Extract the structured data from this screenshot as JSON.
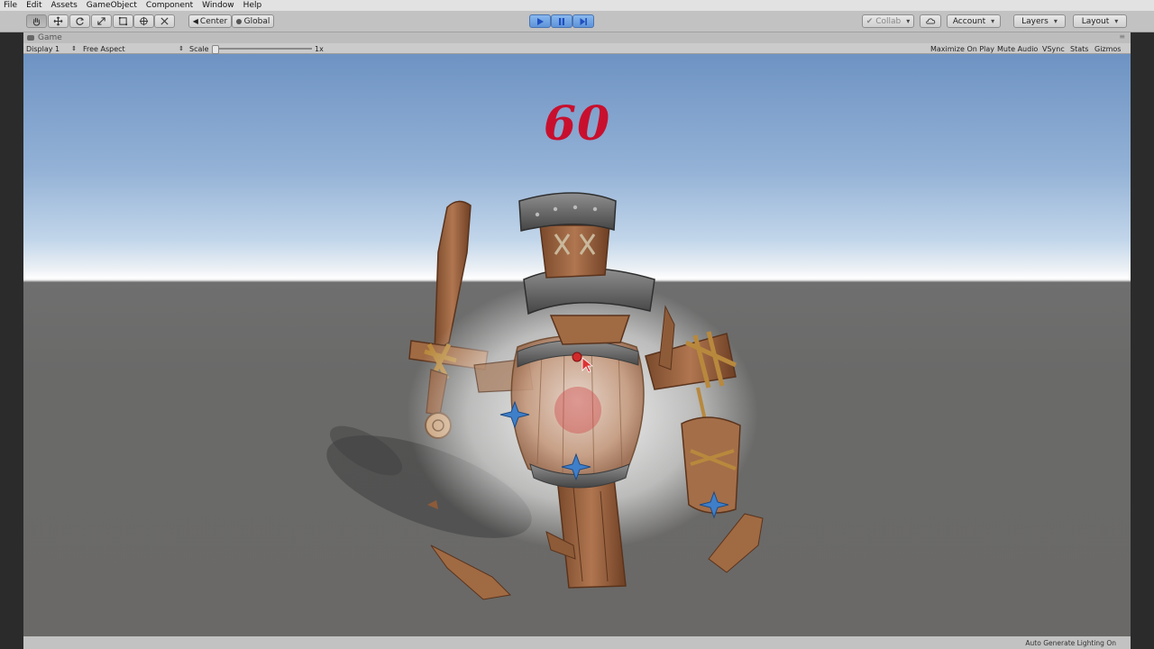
{
  "menu": [
    "File",
    "Edit",
    "Assets",
    "GameObject",
    "Component",
    "Window",
    "Help"
  ],
  "toolbar": {
    "tools": [
      "hand-tool",
      "move-tool",
      "rotate-tool",
      "scale-tool",
      "rect-tool",
      "transform-tool",
      "custom-tool"
    ],
    "pivot_label": "Center",
    "space_label": "Global",
    "collab_label": "Collab",
    "account_label": "Account",
    "layers_label": "Layers",
    "layout_label": "Layout"
  },
  "tab": {
    "label": "Game"
  },
  "game_bar": {
    "display": "Display 1",
    "aspect": "Free Aspect",
    "scale_label": "Scale",
    "scale_value": "1x",
    "maximize": "Maximize On Play",
    "mute": "Mute Audio",
    "vsync": "VSync",
    "stats": "Stats",
    "gizmos": "Gizmos"
  },
  "scene": {
    "counter": "60"
  },
  "status": {
    "lighting": "Auto Generate Lighting On"
  },
  "colors": {
    "play_accent": "#5e93d8",
    "counter": "#c8102e"
  }
}
